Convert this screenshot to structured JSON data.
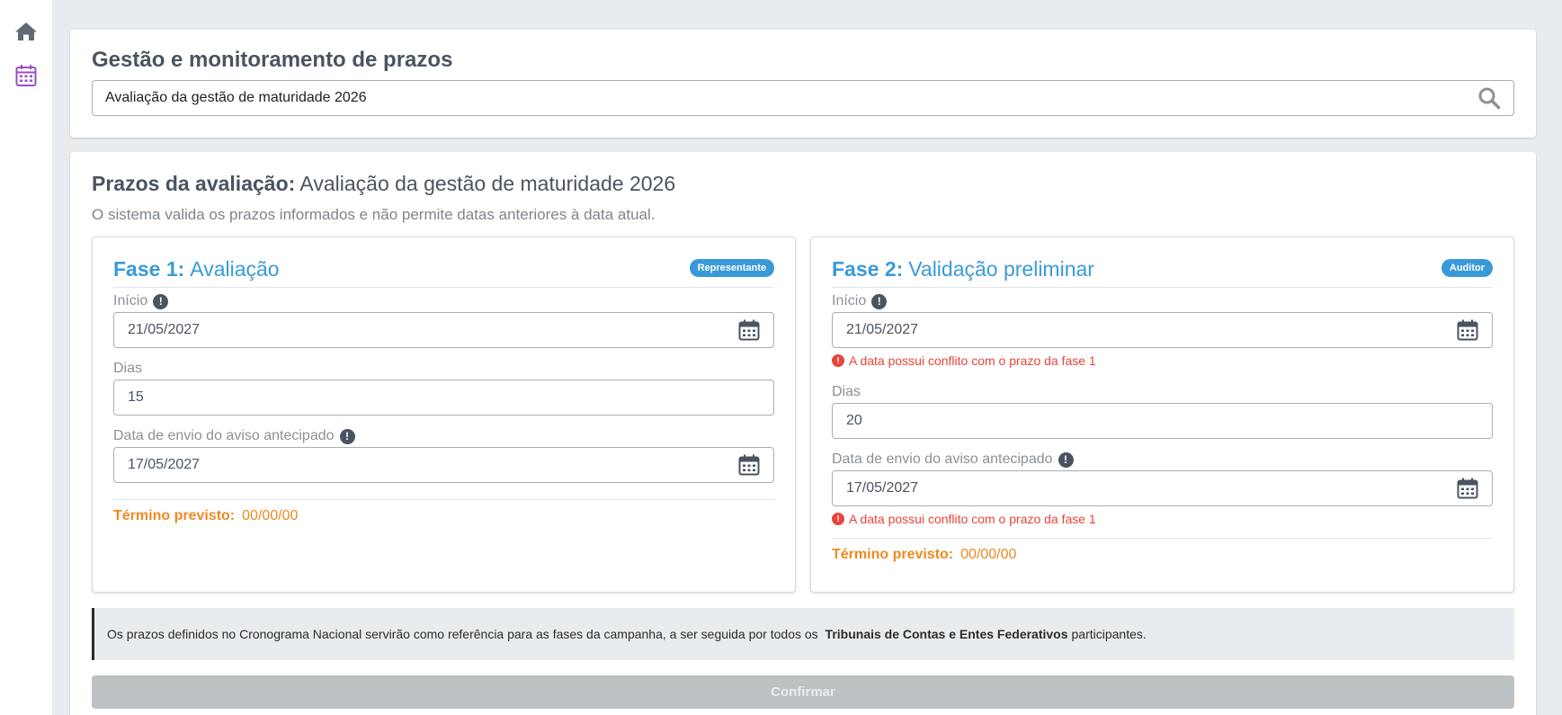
{
  "nav": {
    "items": [
      {
        "icon": "home-icon"
      },
      {
        "icon": "calendar-icon",
        "active": true
      }
    ]
  },
  "header": {
    "title": "Gestão e monitoramento de prazos",
    "search_value": "Avaliação da gestão de maturidade 2026"
  },
  "section": {
    "title_label": "Prazos da avaliação:",
    "title_value": "Avaliação da gestão de maturidade 2026",
    "subtitle": "O sistema valida os prazos informados e não permite datas anteriores à data atual."
  },
  "phases": [
    {
      "number": "Fase 1:",
      "name": "Avaliação",
      "badge": "Representante",
      "inicio_label": "Início",
      "inicio_value": "21/05/2027",
      "dias_label": "Dias",
      "dias_value": "15",
      "aviso_label": "Data de envio do aviso antecipado",
      "aviso_value": "17/05/2027",
      "termino_label": "Término previsto:",
      "termino_value": "00/00/00"
    },
    {
      "number": "Fase 2:",
      "name": "Validação preliminar",
      "badge": "Auditor",
      "inicio_label": "Início",
      "inicio_value": "21/05/2027",
      "inicio_error": "A data  possui conflito com o prazo da fase 1",
      "dias_label": "Dias",
      "dias_value": "20",
      "aviso_label": "Data de envio do aviso antecipado",
      "aviso_value": "17/05/2027",
      "aviso_error": "A data  possui conflito com o prazo da fase 1",
      "termino_label": "Término previsto:",
      "termino_value": "00/00/00"
    }
  ],
  "notice": {
    "text_before": "Os prazos definidos no Cronograma Nacional servirão como referência para as fases da campanha, a ser seguida por todos os",
    "text_bold": "Tribunais de Contas e Entes Federativos",
    "text_after": "participantes."
  },
  "confirm_label": "Confirmar",
  "colors": {
    "accent": "#3a9ad9",
    "error": "#e8443a",
    "warning": "#ed8a22",
    "nav_active": "#9b4fc6"
  }
}
